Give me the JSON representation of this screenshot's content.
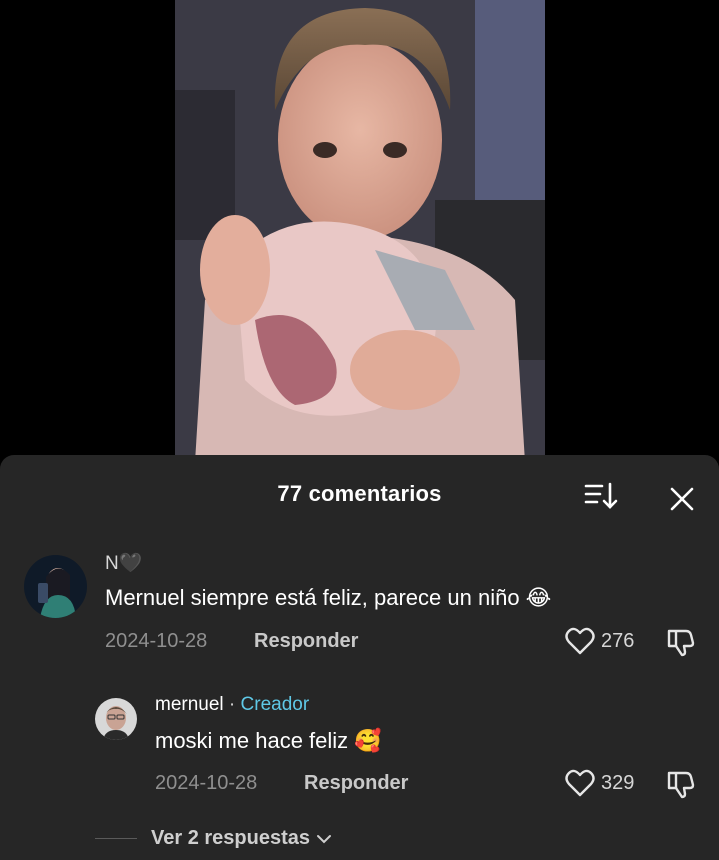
{
  "sheet": {
    "title": "77 comentarios",
    "sort_icon": "sort-descending-icon",
    "close_icon": "close-icon"
  },
  "comments": [
    {
      "username": "N🖤",
      "text": "Mernuel siempre está feliz, parece un niño 😂",
      "date": "2024-10-28",
      "reply_label": "Responder",
      "likes": "276"
    }
  ],
  "reply": {
    "username": "mernuel",
    "separator": " · ",
    "badge": "Creador",
    "text": "moski me hace feliz 🥰",
    "date": "2024-10-28",
    "reply_label": "Responder",
    "likes": "329"
  },
  "view_replies": "Ver 2 respuestas",
  "colors": {
    "sheet_bg": "#262626",
    "creator_badge": "#5fc8e6",
    "meta_text": "#8f8f8f"
  }
}
